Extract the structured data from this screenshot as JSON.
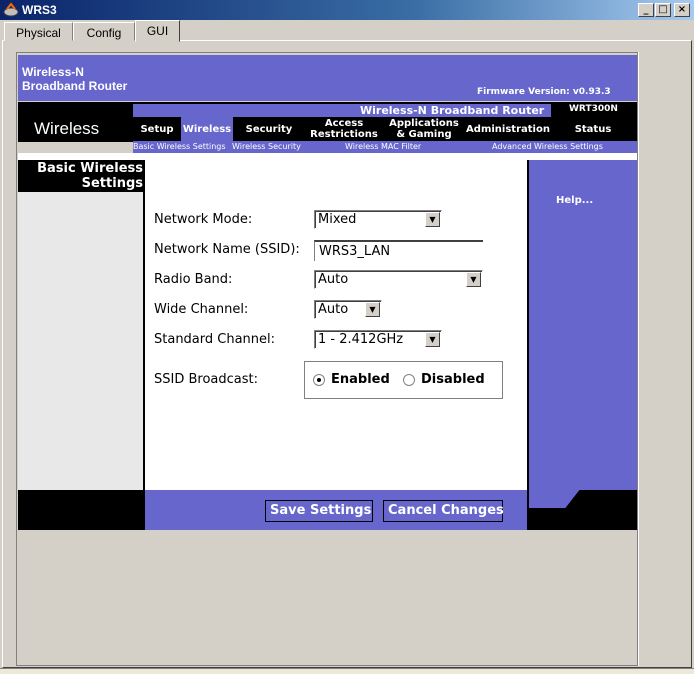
{
  "window": {
    "title": "WRS3",
    "min": "_",
    "max": "□",
    "close": "×"
  },
  "tabs": [
    {
      "label": "Physical"
    },
    {
      "label": "Config"
    },
    {
      "label": "GUI"
    }
  ],
  "router": {
    "brand_line1": "Wireless-N",
    "brand_line2": "Broadband Router",
    "firmware": "Firmware Version: v0.93.3",
    "product_name": "Wireless-N Broadband Router",
    "model": "WRT300N",
    "section": "Wireless",
    "nav": [
      {
        "label": "Setup"
      },
      {
        "label": "Wireless"
      },
      {
        "label": "Security"
      },
      {
        "label": "Access Restrictions"
      },
      {
        "label": "Applications & Gaming"
      },
      {
        "label": "Administration"
      },
      {
        "label": "Status"
      }
    ],
    "subnav": [
      {
        "label": "Basic Wireless Settings"
      },
      {
        "label": "Wireless Security"
      },
      {
        "label": "Wireless MAC Filter"
      },
      {
        "label": "Advanced Wireless Settings"
      }
    ]
  },
  "page": {
    "title_line1": "Basic Wireless",
    "title_line2": "Settings",
    "help": "Help..."
  },
  "form": {
    "network_mode": {
      "label": "Network Mode:",
      "value": "Mixed"
    },
    "ssid": {
      "label": "Network Name (SSID):",
      "value": "WRS3_LAN"
    },
    "radio_band": {
      "label": "Radio Band:",
      "value": "Auto"
    },
    "wide_channel": {
      "label": "Wide Channel:",
      "value": "Auto"
    },
    "standard_channel": {
      "label": "Standard Channel:",
      "value": "1 - 2.412GHz"
    },
    "ssid_broadcast": {
      "label": "SSID Broadcast:",
      "enabled": "Enabled",
      "disabled": "Disabled",
      "selected": "Enabled"
    }
  },
  "footer": {
    "save": "Save Settings",
    "cancel": "Cancel Changes"
  },
  "colors": {
    "brand_purple": "#6666cc",
    "black": "#000000",
    "window_gray": "#d4d0c8"
  },
  "icons": {
    "app": "router-icon",
    "arrow": "chevron-down-icon"
  }
}
